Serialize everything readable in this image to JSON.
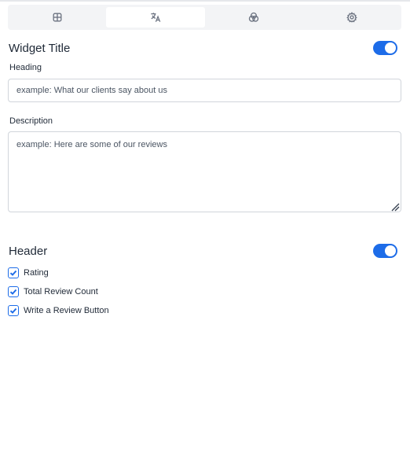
{
  "tabs": [
    {
      "icon": "layout-grid-icon",
      "active": false
    },
    {
      "icon": "translate-icon",
      "active": true
    },
    {
      "icon": "color-circles-icon",
      "active": false
    },
    {
      "icon": "gear-icon",
      "active": false
    }
  ],
  "widget_title": {
    "title": "Widget Title",
    "enabled": true,
    "heading_label": "Heading",
    "heading_placeholder": "example: What our clients say about us",
    "description_label": "Description",
    "description_placeholder": "example: Here are some of our reviews"
  },
  "header": {
    "title": "Header",
    "enabled": true,
    "options": [
      {
        "label": "Rating",
        "checked": true
      },
      {
        "label": "Total Review Count",
        "checked": true
      },
      {
        "label": "Write a Review Button",
        "checked": true
      }
    ]
  },
  "colors": {
    "accent": "#1d6ce8",
    "tab_bar_bg": "#f3f4f6",
    "border": "#d1d5db"
  }
}
